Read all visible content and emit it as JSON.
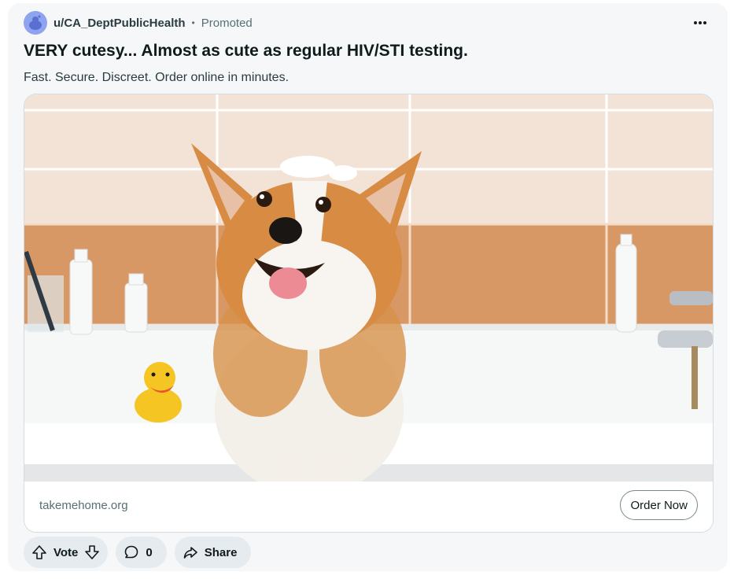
{
  "post": {
    "username": "u/CA_DeptPublicHealth",
    "separator": "•",
    "status": "Promoted",
    "title": "VERY cutesy... Almost as cute as regular HIV/STI testing.",
    "subtitle": "Fast. Secure. Discreet. Order online in minutes."
  },
  "link": {
    "domain": "takemehome.org",
    "cta_label": "Order Now"
  },
  "actions": {
    "vote_label": "Vote",
    "comment_count": "0",
    "share_label": "Share"
  },
  "icons": {
    "avatar": "reddit-snoo-icon",
    "more": "more-options-icon",
    "upvote": "arrow-up-icon",
    "downvote": "arrow-down-icon",
    "comment": "comment-bubble-icon",
    "share": "share-arrow-icon"
  },
  "colors": {
    "card_bg": "#f5f7f8",
    "pill_bg": "#e5ebee",
    "avatar": "#8ea4f0"
  }
}
